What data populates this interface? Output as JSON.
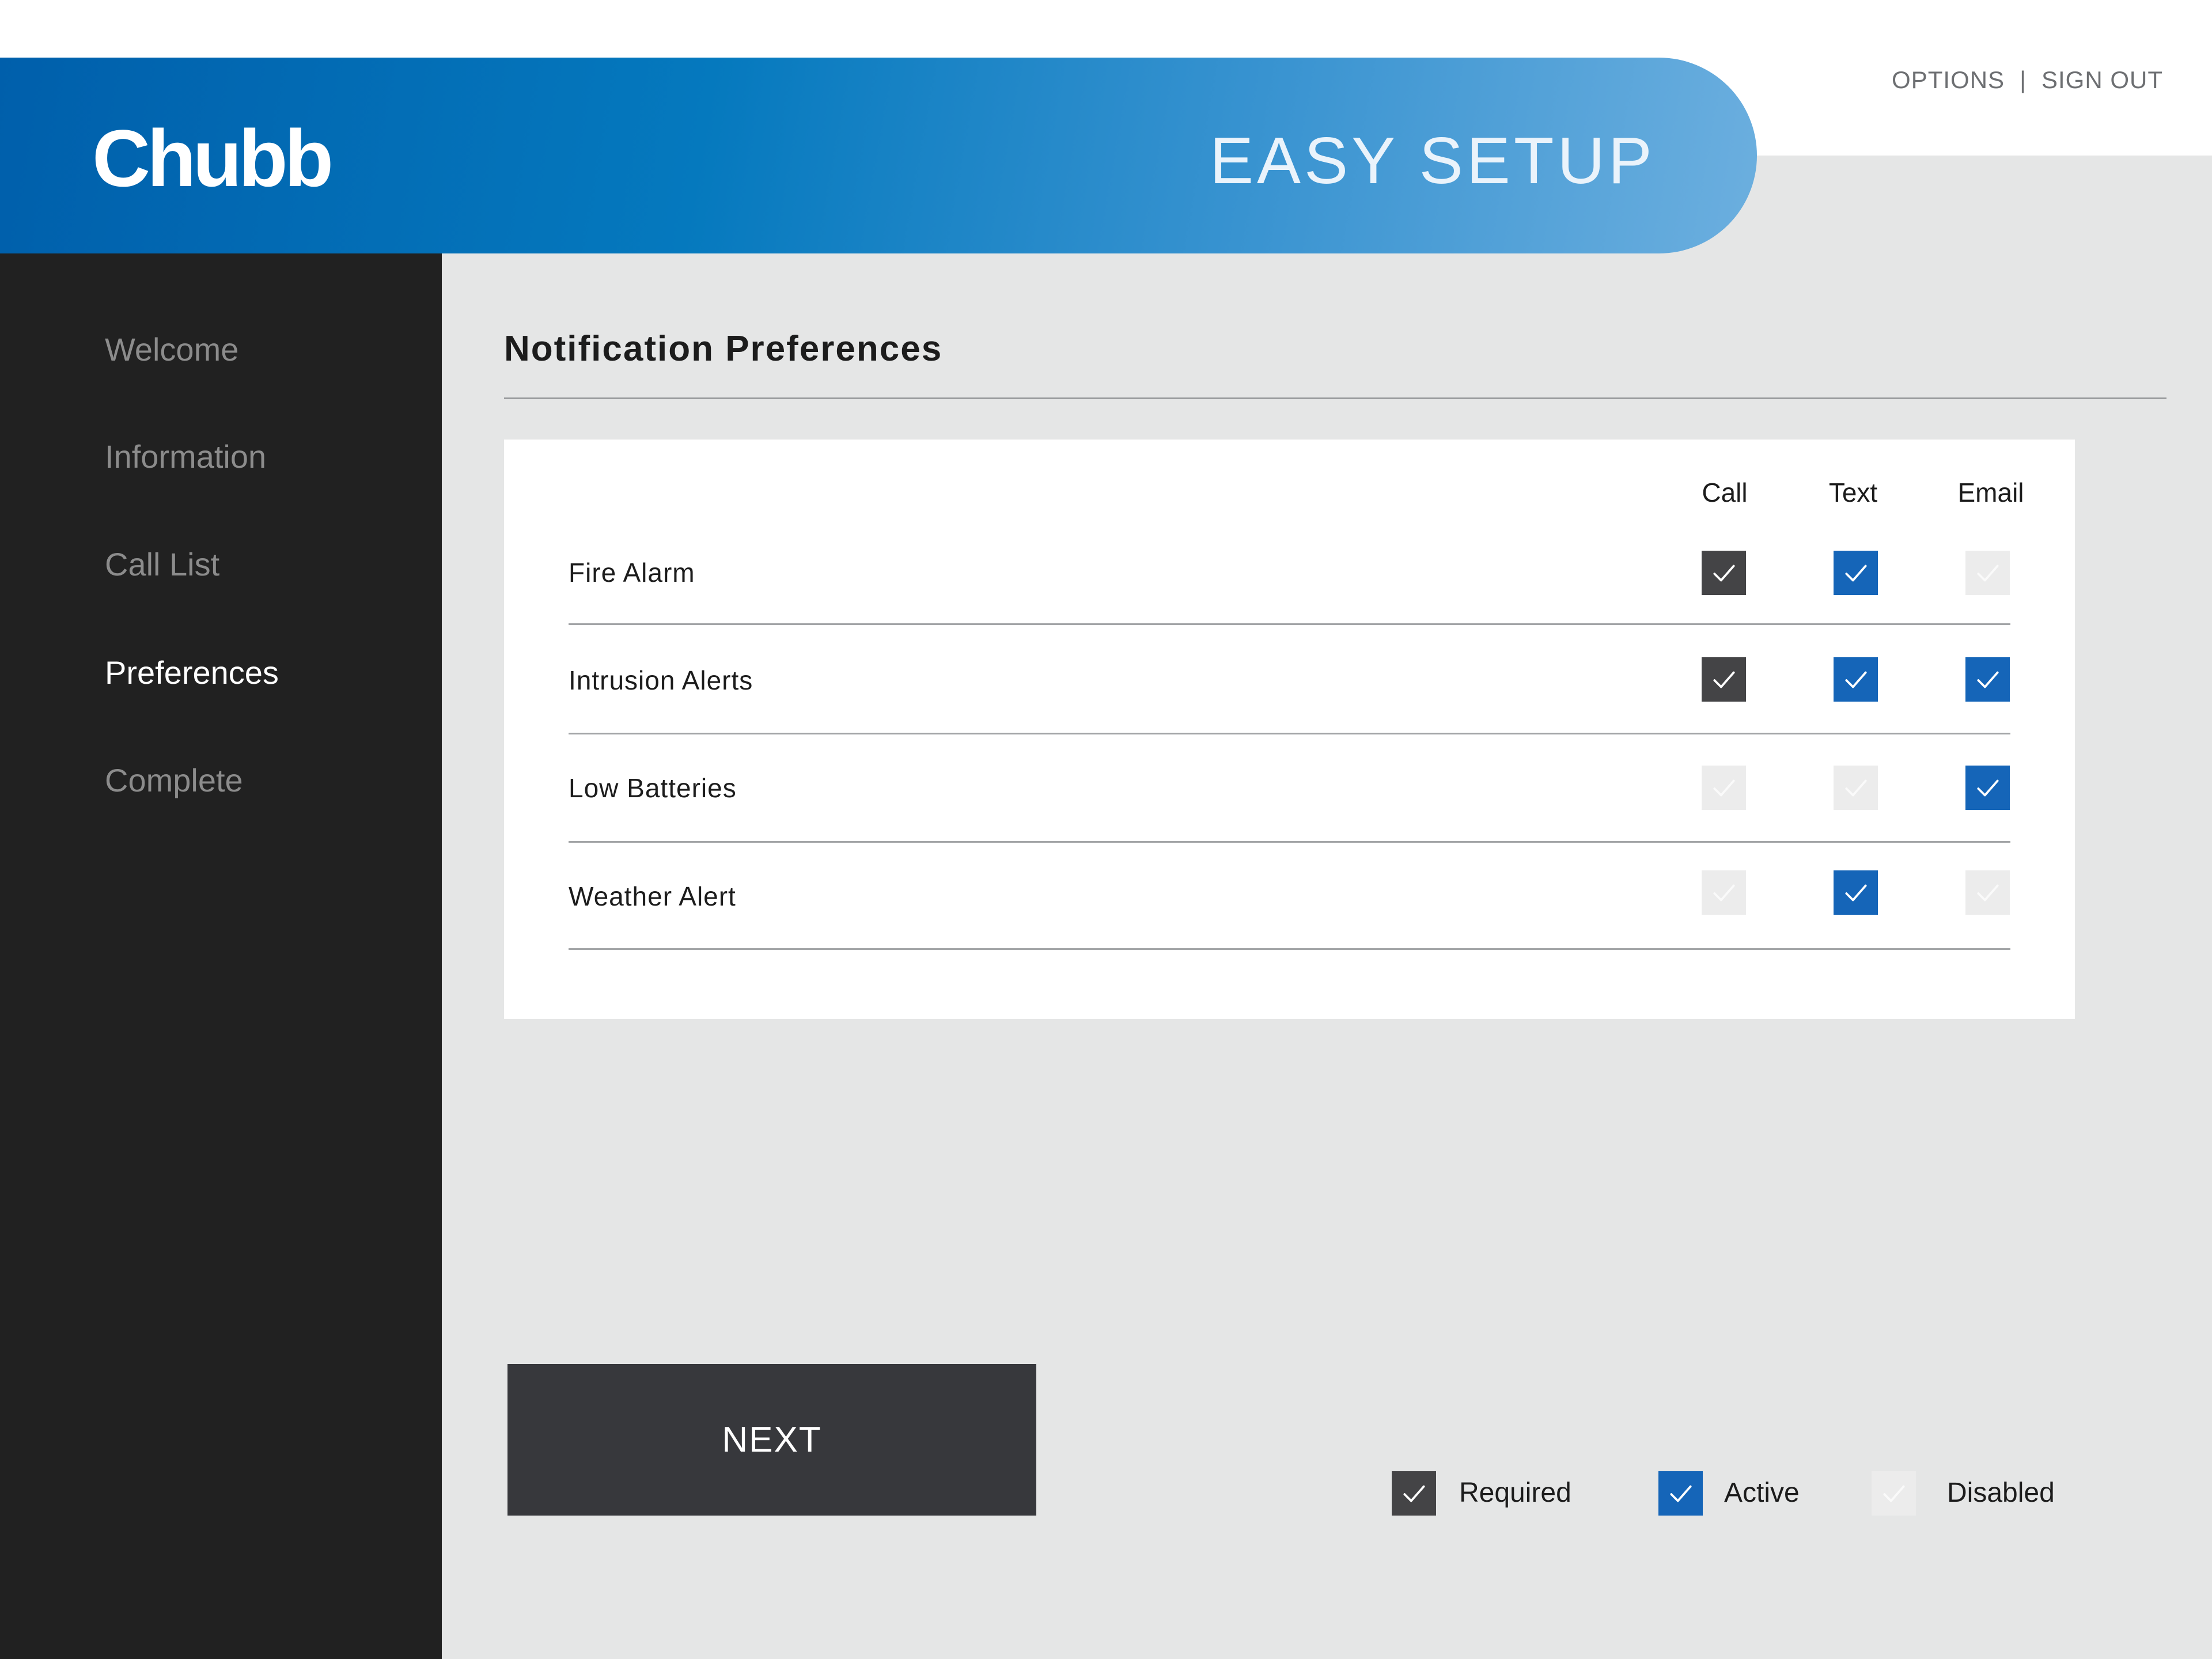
{
  "brand": {
    "logo_text": "Chubb",
    "color": "#0579be"
  },
  "header": {
    "title": "EASY SETUP",
    "options_label": "OPTIONS",
    "separator": "|",
    "signout_label": "SIGN OUT"
  },
  "sidebar": {
    "items": [
      {
        "label": "Welcome",
        "active": false
      },
      {
        "label": "Information",
        "active": false
      },
      {
        "label": "Call List",
        "active": false
      },
      {
        "label": "Preferences",
        "active": true
      },
      {
        "label": "Complete",
        "active": false
      }
    ]
  },
  "main": {
    "section_title": "Notification Preferences",
    "columns": [
      "Call",
      "Text",
      "Email"
    ],
    "rows": [
      {
        "label": "Fire Alarm",
        "states": [
          "required",
          "active",
          "disabled"
        ]
      },
      {
        "label": "Intrusion Alerts",
        "states": [
          "required",
          "active",
          "active"
        ]
      },
      {
        "label": "Low Batteries",
        "states": [
          "disabled",
          "disabled",
          "active"
        ]
      },
      {
        "label": "Weather Alert",
        "states": [
          "disabled",
          "active",
          "disabled"
        ]
      }
    ]
  },
  "actions": {
    "next_label": "NEXT"
  },
  "legend": {
    "items": [
      {
        "state": "required",
        "label": "Required"
      },
      {
        "state": "active",
        "label": "Active"
      },
      {
        "state": "disabled",
        "label": "Disabled"
      }
    ]
  },
  "colors": {
    "required": "#444446",
    "active": "#1565b8",
    "disabled": "#ececec",
    "sidebar_bg": "#212121",
    "content_bg": "#e5e6e6"
  },
  "icons": {
    "checkmark": "check-icon"
  }
}
